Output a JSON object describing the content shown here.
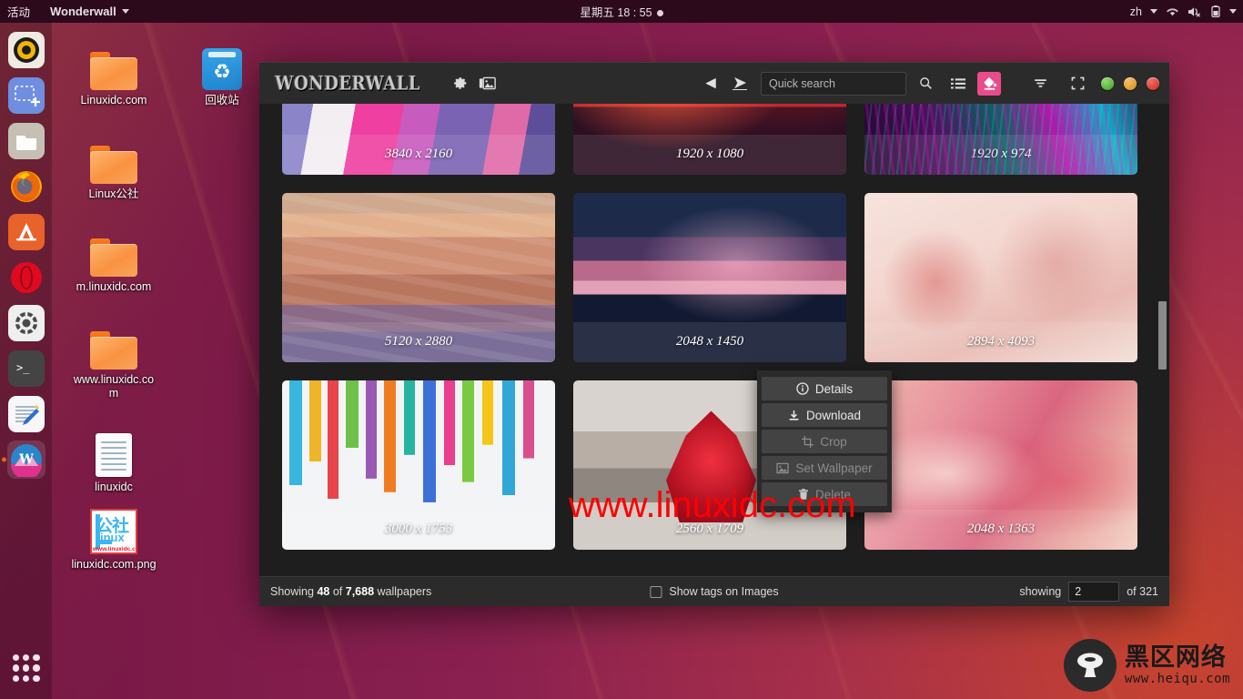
{
  "topbar": {
    "activities": "活动",
    "app_name": "Wonderwall",
    "clock": "星期五 18 : 55",
    "keyboard_layout": "zh",
    "icons": [
      "wifi-icon",
      "volume-muted-icon",
      "battery-icon"
    ]
  },
  "dock": {
    "items": [
      {
        "name": "media-player",
        "label": "Rhythmbox"
      },
      {
        "name": "screenshot-tool",
        "label": "Screenshot"
      },
      {
        "name": "files",
        "label": "Files"
      },
      {
        "name": "firefox",
        "label": "Firefox"
      },
      {
        "name": "ubuntu-software",
        "label": "Ubuntu Software"
      },
      {
        "name": "opera",
        "label": "Opera"
      },
      {
        "name": "settings",
        "label": "Settings"
      },
      {
        "name": "terminal",
        "label": "Terminal"
      },
      {
        "name": "text-editor",
        "label": "Text Editor"
      },
      {
        "name": "wonderwall",
        "label": "Wonderwall",
        "active": true
      }
    ],
    "show_apps_label": "Show Applications"
  },
  "desktop_icons": [
    {
      "type": "folder",
      "label": "Linuxidc.com"
    },
    {
      "type": "trash",
      "label": "回收站"
    },
    {
      "type": "folder",
      "label": "Linux公社"
    },
    {
      "type": "folder",
      "label": "m.linuxidc.com"
    },
    {
      "type": "folder",
      "label": "www.linuxidc.com"
    },
    {
      "type": "document",
      "label": "linuxidc"
    },
    {
      "type": "image",
      "label": "linuxidc.com.png"
    }
  ],
  "app": {
    "logo_text": "WONDERWALL",
    "toolbar": {
      "settings_label": "Settings",
      "library_label": "Library",
      "back_label": "Back",
      "forward_label": "Forward",
      "search_placeholder": "Quick search",
      "search_value": "",
      "search_button_label": "Search",
      "list_view_label": "List view",
      "fill_label": "Palette",
      "filter_label": "Filter",
      "fullscreen_label": "Fullscreen"
    },
    "window_buttons": [
      {
        "name": "minimize",
        "color": "#4caf37"
      },
      {
        "name": "maximize",
        "color": "#e09a1e"
      },
      {
        "name": "close",
        "color": "#e03b2f"
      }
    ],
    "context_menu": [
      {
        "label": "Details",
        "icon": "info-icon",
        "disabled": false
      },
      {
        "label": "Download",
        "icon": "download-icon",
        "disabled": false
      },
      {
        "label": "Crop",
        "icon": "crop-icon",
        "disabled": true
      },
      {
        "label": "Set Wallpaper",
        "icon": "wallpaper-icon",
        "disabled": true
      },
      {
        "label": "Delete",
        "icon": "trash-icon",
        "disabled": true
      }
    ],
    "thumbnails": [
      {
        "resolution": "3840 x 2160",
        "art": "t1"
      },
      {
        "resolution": "1920 x 1080",
        "art": "t2"
      },
      {
        "resolution": "1920 x 974",
        "art": "t3"
      },
      {
        "resolution": "5120 x 2880",
        "art": "t4"
      },
      {
        "resolution": "2048 x 1450",
        "art": "t5"
      },
      {
        "resolution": "2894 x 4093",
        "art": "t6"
      },
      {
        "resolution": "3000 x 1753",
        "art": "t7"
      },
      {
        "resolution": "2560 x 1709",
        "art": "t8"
      },
      {
        "resolution": "2048 x 1363",
        "art": "t9"
      }
    ],
    "status": {
      "showing_prefix": "Showing",
      "shown_count": "48",
      "of_label": "of",
      "total_count": "7,688",
      "items_label": "wallpapers",
      "tags_checkbox_label": "Show tags on Images",
      "tags_checked": false,
      "page_prefix": "showing",
      "page_value": "2",
      "page_suffix": "of 321"
    }
  },
  "watermarks": {
    "overlay_url": "www.linuxidc.com",
    "corner_cn": "黑区网络",
    "corner_url": "www.heiqu.com"
  }
}
